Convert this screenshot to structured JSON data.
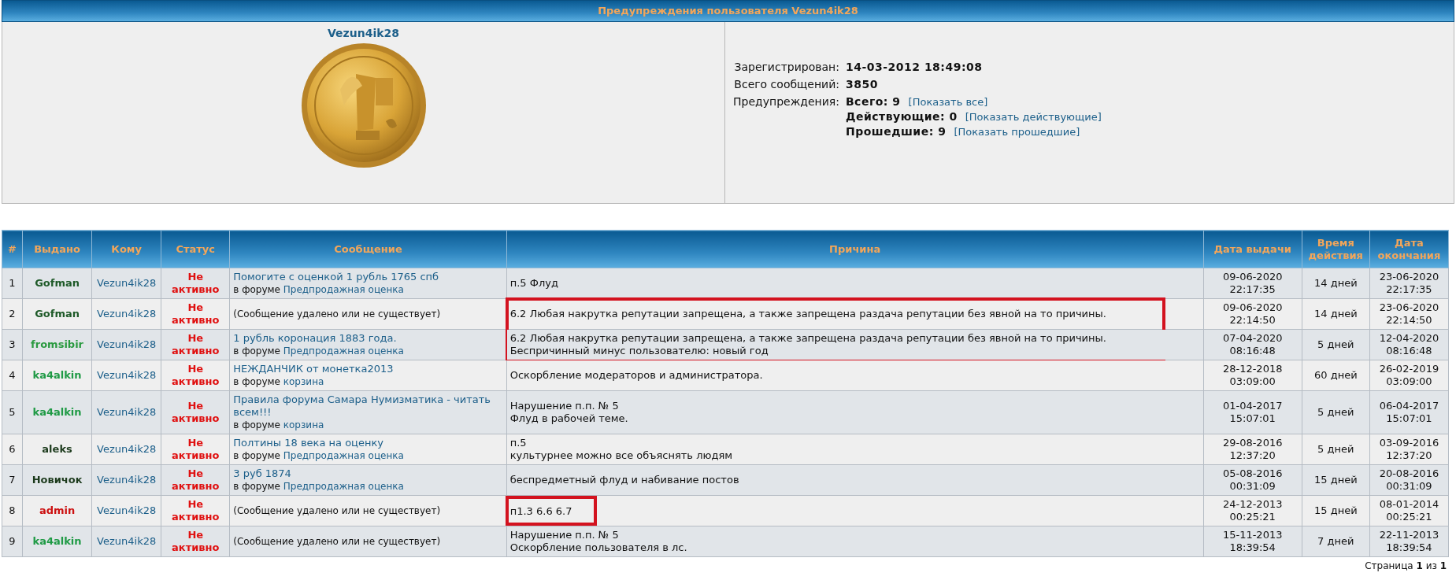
{
  "page_title": "Предупреждения пользователя Vezun4ik28",
  "profile": {
    "username": "Vezun4ik28",
    "fields": [
      {
        "label": "Зарегистрирован:",
        "values": [
          {
            "text": "14-03-2012 18:49:08"
          }
        ]
      },
      {
        "label": "Всего сообщений:",
        "values": [
          {
            "text": "3850"
          }
        ]
      },
      {
        "label": "Предупреждения:",
        "values": [
          {
            "text": "Всего: 9",
            "link": "[Показать все]"
          },
          {
            "text": "Действующие: 0",
            "link": "[Показать действующие]"
          },
          {
            "text": "Прошедшие: 9",
            "link": "[Показать прошедшие]"
          }
        ]
      }
    ]
  },
  "table": {
    "columns": [
      "#",
      "Выдано",
      "Кому",
      "Статус",
      "Сообщение",
      "Причина",
      "Дата выдачи",
      "Время действия",
      "Дата окончания"
    ],
    "rows": [
      {
        "num": "1",
        "issuer": "Gofman",
        "color": "#1e5a28",
        "target": "Vezun4ik28",
        "status": "Не активно",
        "active": false,
        "message": {
          "kind": "link",
          "title": "Помогите с оценкой 1 рубль 1765 спб",
          "prefix": "в форуме",
          "forum": "Предпродажная оценка"
        },
        "reason": [
          "п.5 Флуд"
        ],
        "outlined": false,
        "issued": "09-06-2020 22:17:35",
        "duration": "14 дней",
        "ends": "23-06-2020 22:17:35"
      },
      {
        "num": "2",
        "issuer": "Gofman",
        "color": "#1e5a28",
        "target": "Vezun4ik28",
        "status": "Не активно",
        "active": false,
        "message": {
          "kind": "deleted",
          "text": "(Сообщение удалено или не существует)"
        },
        "reason": [
          "6.2 Любая накрутка репутации запрещена, а также запрещена раздача репутации без явной на то причины."
        ],
        "outlined": true,
        "issued": "09-06-2020 22:14:50",
        "duration": "14 дней",
        "ends": "23-06-2020 22:14:50"
      },
      {
        "num": "3",
        "issuer": "fromsibir",
        "color": "#2a9a40",
        "target": "Vezun4ik28",
        "status": "Не активно",
        "active": false,
        "message": {
          "kind": "link",
          "title": "1 рубль коронация 1883 года.",
          "prefix": "в форуме",
          "forum": "Предпродажная оценка"
        },
        "reason": [
          "6.2 Любая накрутка репутации запрещена, а также запрещена раздача репутации без явной на то причины.",
          "Беспричинный минус пользователю: новый год"
        ],
        "outlined": true,
        "issued": "07-04-2020 08:16:48",
        "duration": "5 дней",
        "ends": "12-04-2020 08:16:48"
      },
      {
        "num": "4",
        "issuer": "ka4alkin",
        "color": "#1f9a45",
        "target": "Vezun4ik28",
        "status": "Не активно",
        "active": false,
        "message": {
          "kind": "link",
          "title": "НЕЖДАНЧИК от монетка2013",
          "prefix": "в форуме",
          "forum": "корзина"
        },
        "reason": [
          "Оскорбление модераторов и администратора."
        ],
        "outlined": false,
        "issued": "28-12-2018 03:09:00",
        "duration": "60 дней",
        "ends": "26-02-2019 03:09:00"
      },
      {
        "num": "5",
        "issuer": "ka4alkin",
        "color": "#1f9a45",
        "target": "Vezun4ik28",
        "status": "Не активно",
        "active": false,
        "message": {
          "kind": "link",
          "title": "Правила форума Самара Нумизматика - читать всем!!!",
          "prefix": "в форуме",
          "forum": "корзина"
        },
        "reason": [
          "Нарушение п.п. № 5",
          "Флуд в рабочей теме."
        ],
        "outlined": false,
        "issued": "01-04-2017 15:07:01",
        "duration": "5 дней",
        "ends": "06-04-2017 15:07:01"
      },
      {
        "num": "6",
        "issuer": "aleks",
        "color": "#1c3a1c",
        "target": "Vezun4ik28",
        "status": "Не активно",
        "active": false,
        "message": {
          "kind": "link",
          "title": "Полтины 18 века на оценку",
          "prefix": "в форуме",
          "forum": "Предпродажная оценка"
        },
        "reason": [
          "п.5",
          "культурнее можно все объяснять людям"
        ],
        "outlined": false,
        "issued": "29-08-2016 12:37:20",
        "duration": "5 дней",
        "ends": "03-09-2016 12:37:20"
      },
      {
        "num": "7",
        "issuer": "Новичок",
        "color": "#1c3a1c",
        "target": "Vezun4ik28",
        "status": "Не активно",
        "active": false,
        "message": {
          "kind": "link",
          "title": "3 руб 1874",
          "prefix": "в форуме",
          "forum": "Предпродажная оценка"
        },
        "reason": [
          "беспредметный флуд и набивание постов"
        ],
        "outlined": false,
        "issued": "05-08-2016 00:31:09",
        "duration": "15 дней",
        "ends": "20-08-2016 00:31:09"
      },
      {
        "num": "8",
        "issuer": "admin",
        "color": "#cc1111",
        "target": "Vezun4ik28",
        "status": "Не активно",
        "active": false,
        "message": {
          "kind": "deleted",
          "text": "(Сообщение удалено или не существует)"
        },
        "reason": [
          "п1.3 6.6 6.7"
        ],
        "outlined": true,
        "issued": "24-12-2013 00:25:21",
        "duration": "15 дней",
        "ends": "08-01-2014 00:25:21"
      },
      {
        "num": "9",
        "issuer": "ka4alkin",
        "color": "#1f9a45",
        "target": "Vezun4ik28",
        "status": "Не активно",
        "active": false,
        "message": {
          "kind": "deleted",
          "text": "(Сообщение удалено или не существует)"
        },
        "reason": [
          "Нарушение п.п. № 5",
          "Оскорбление пользователя в лс."
        ],
        "outlined": false,
        "issued": "15-11-2013 18:39:54",
        "duration": "7 дней",
        "ends": "22-11-2013 18:39:54"
      }
    ]
  },
  "pagination": "Страница **1** из **1**"
}
